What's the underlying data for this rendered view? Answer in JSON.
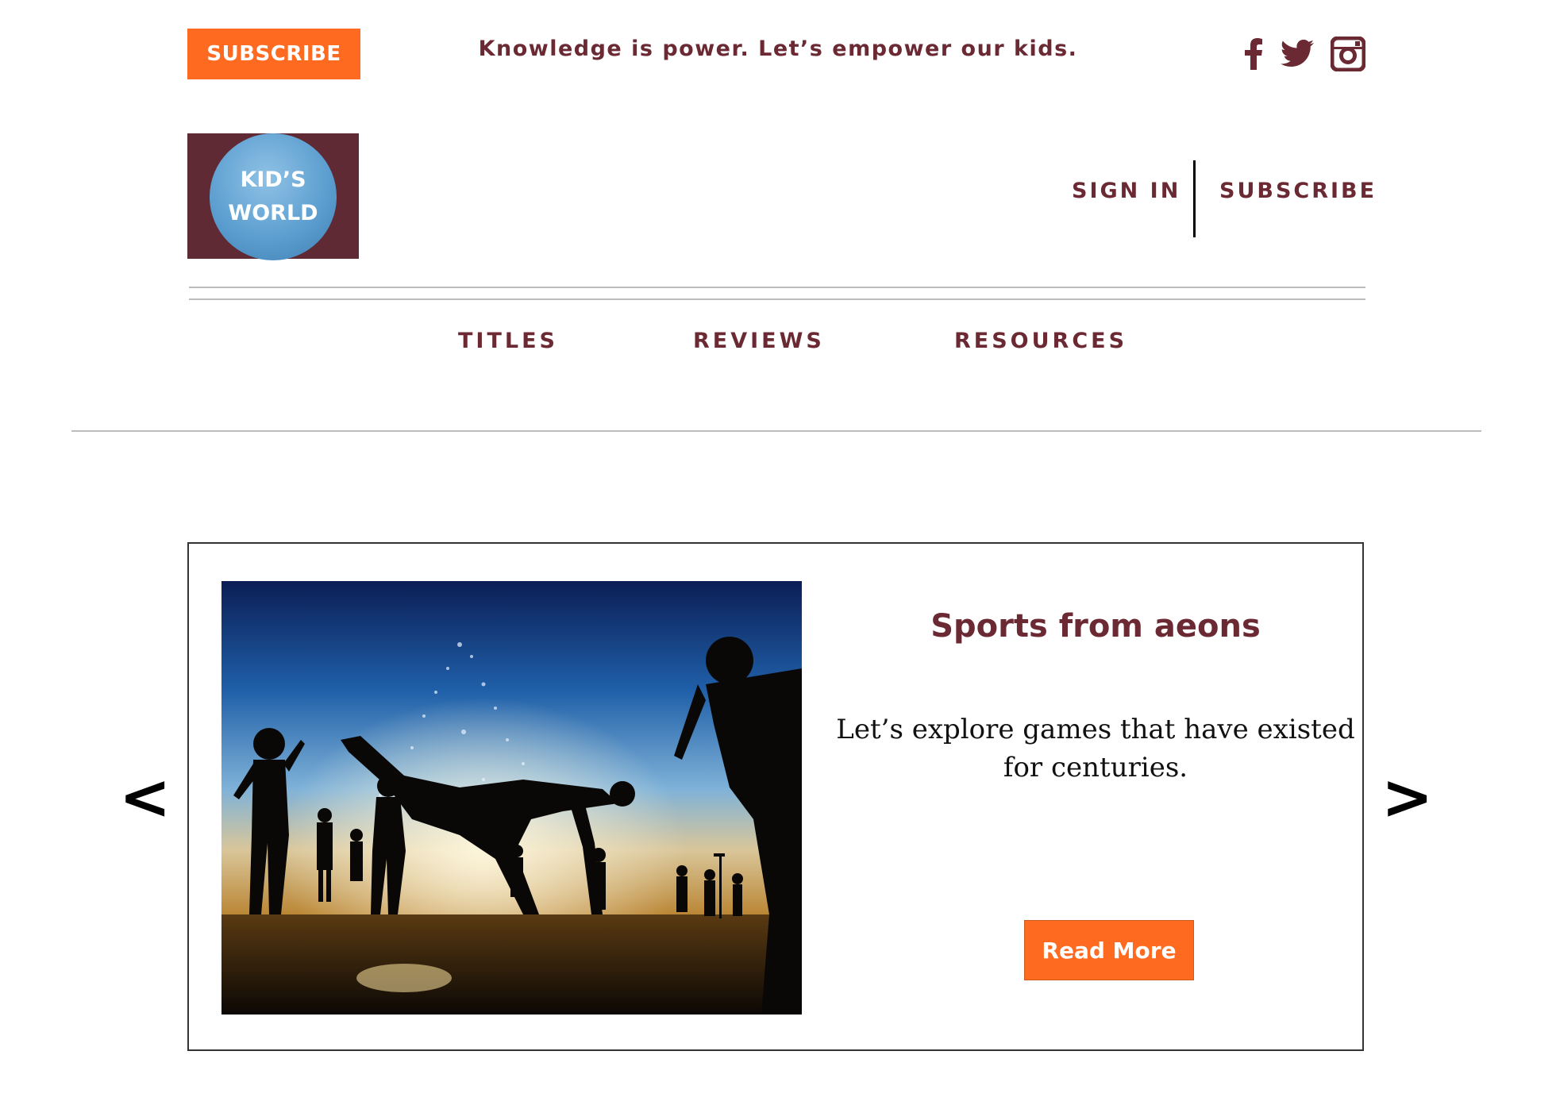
{
  "header": {
    "subscribe_label": "SUBSCRIBE",
    "tagline": "Knowledge is power. Let’s empower our kids.",
    "social": [
      "facebook-icon",
      "twitter-icon",
      "instagram-icon"
    ]
  },
  "logo": {
    "line1": "KID’S",
    "line2": "WORLD"
  },
  "account": {
    "sign_in": "SIGN IN",
    "subscribe": "SUBSCRIBE"
  },
  "nav": {
    "items": [
      {
        "label": "TITLES"
      },
      {
        "label": "REVIEWS"
      },
      {
        "label": "RESOURCES"
      }
    ]
  },
  "carousel": {
    "prev": "<",
    "next": ">",
    "slide": {
      "title": "Sports from aeons",
      "text": "Let’s explore games that have existed for centuries.",
      "button": "Read More",
      "image": "children-playing-in-water-fountain-silhouette"
    }
  },
  "colors": {
    "accent": "#ff6a21",
    "brand": "#6b2a33",
    "logo_bg": "#5f2a34"
  }
}
